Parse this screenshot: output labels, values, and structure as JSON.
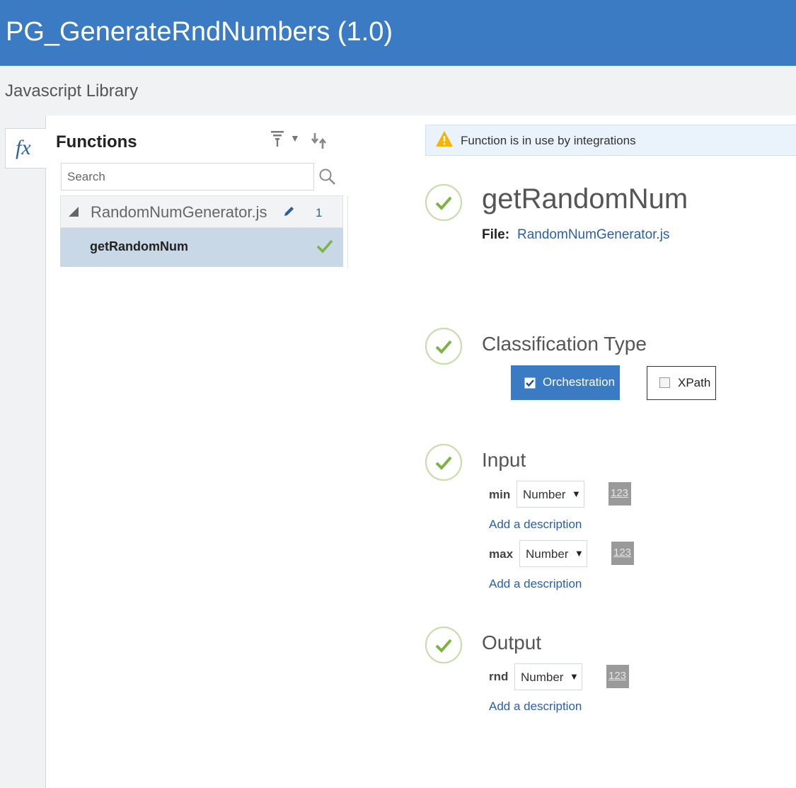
{
  "header": {
    "title": "PG_GenerateRndNumbers (1.0)"
  },
  "subheader": {
    "label": "Javascript Library"
  },
  "sidebar": {
    "tab_glyph": "fx"
  },
  "functions_panel": {
    "heading": "Functions",
    "search_placeholder": "Search",
    "files": [
      {
        "name": "RandomNumGenerator.js",
        "count": "1",
        "functions": [
          {
            "name": "getRandomNum",
            "status": "valid"
          }
        ]
      }
    ]
  },
  "detail": {
    "warning": "Function is in use by integrations",
    "function_name": "getRandomNum",
    "file_label": "File:",
    "file_name": "RandomNumGenerator.js",
    "classification": {
      "title": "Classification Type",
      "options": [
        {
          "label": "Orchestration",
          "checked": true
        },
        {
          "label": "XPath",
          "checked": false
        }
      ]
    },
    "input": {
      "title": "Input",
      "params": [
        {
          "name": "min",
          "type": "Number",
          "type_icon": "123",
          "description_link": "Add a description"
        },
        {
          "name": "max",
          "type": "Number",
          "type_icon": "123",
          "description_link": "Add a description"
        }
      ]
    },
    "output": {
      "title": "Output",
      "params": [
        {
          "name": "rnd",
          "type": "Number",
          "type_icon": "123",
          "description_link": "Add a description"
        }
      ]
    }
  },
  "colors": {
    "brand": "#3b7bc4",
    "success": "#7cb342",
    "link": "#2a5fa6",
    "warning": "#f5b400"
  }
}
